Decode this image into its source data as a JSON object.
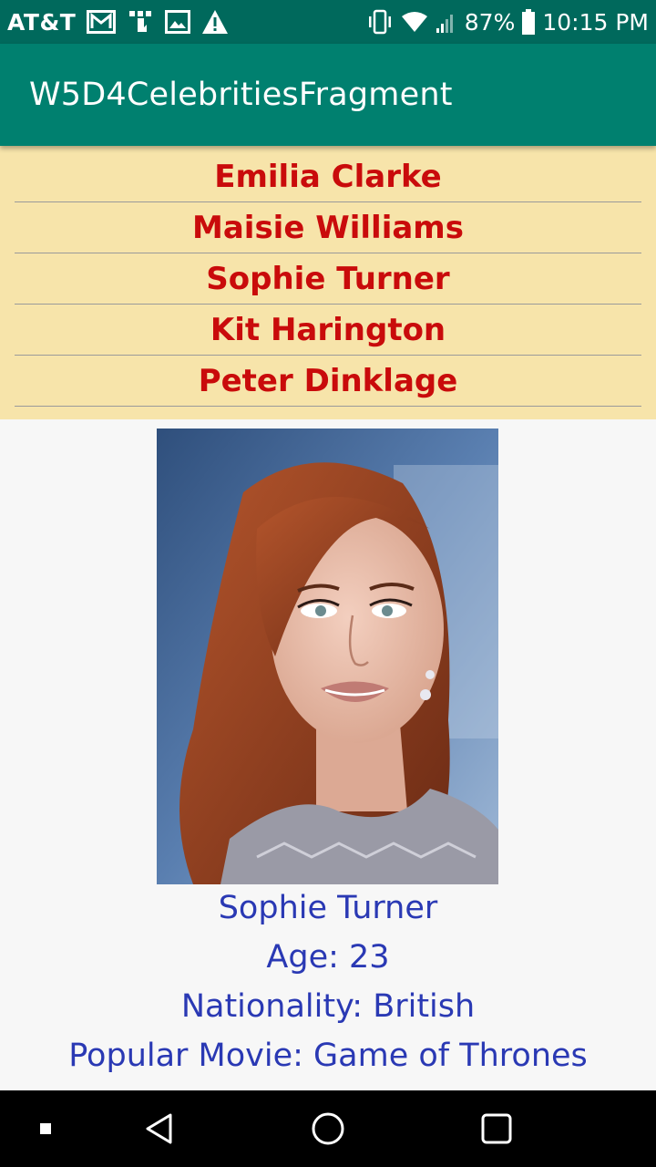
{
  "status_bar": {
    "carrier": "AT&T",
    "battery": "87%",
    "time": "10:15 PM",
    "icons": [
      "gmail-icon",
      "usb-debug-icon",
      "image-icon",
      "warning-icon",
      "vibrate-icon",
      "wifi-icon",
      "cell-signal-icon",
      "battery-icon"
    ]
  },
  "app_bar": {
    "title": "W5D4CelebritiesFragment"
  },
  "celebrity_list": {
    "items": [
      {
        "label": "Emilia Clarke"
      },
      {
        "label": "Maisie Williams"
      },
      {
        "label": "Sophie Turner"
      },
      {
        "label": "Kit Harington"
      },
      {
        "label": "Peter Dinklage"
      }
    ]
  },
  "detail": {
    "name": "Sophie Turner",
    "age": "Age: 23",
    "nationality": "Nationality: British",
    "popular_movie": "Popular Movie: Game of Thrones"
  },
  "nav_bar": {
    "icons": [
      "dot-icon",
      "back-icon",
      "home-icon",
      "recents-icon"
    ]
  },
  "colors": {
    "status_bar": "#00695c",
    "app_bar": "#00806f",
    "list_background": "#f7e4aa",
    "list_text": "#c90b0b",
    "detail_text": "#2a39b4"
  }
}
